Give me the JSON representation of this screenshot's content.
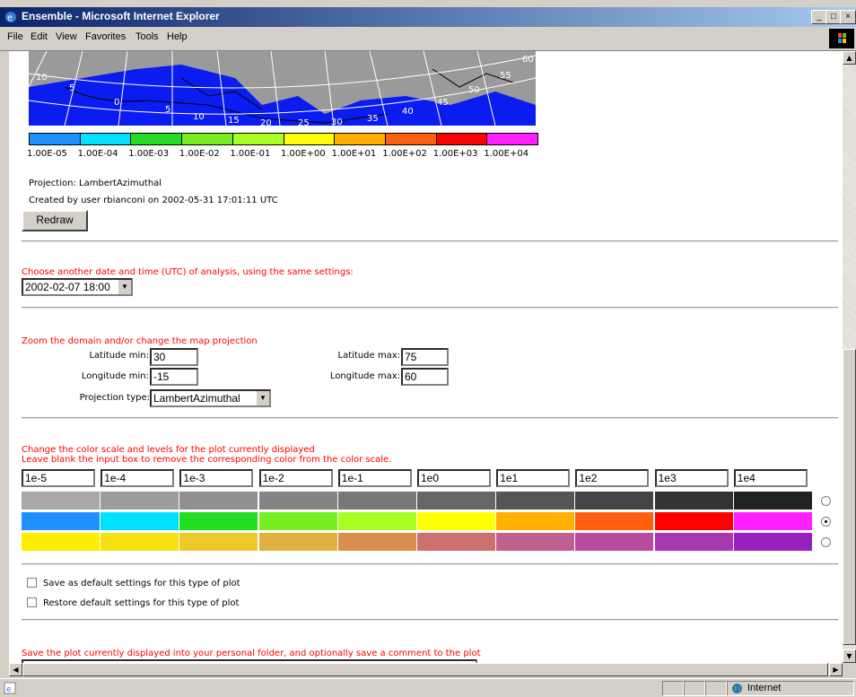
{
  "window": {
    "title": "Ensemble - Microsoft Internet Explorer",
    "minimize": "_",
    "maximize": "□",
    "close": "×"
  },
  "menu": [
    "File",
    "Edit",
    "View",
    "Favorites",
    "Tools",
    "Help"
  ],
  "map": {
    "lat_labels": [
      "10",
      "5",
      "0",
      "5",
      "10",
      "15",
      "20",
      "25",
      "30",
      "35",
      "40",
      "45",
      "50",
      "55",
      "60"
    ]
  },
  "color_scale": {
    "colors": [
      "#1e90ff",
      "#00e0ff",
      "#22dd22",
      "#77ee22",
      "#aaff22",
      "#ffff00",
      "#ffb000",
      "#ff6010",
      "#ff0000",
      "#ff20ff"
    ],
    "labels": [
      "1.00E-05",
      "1.00E-04",
      "1.00E-03",
      "1.00E-02",
      "1.00E-01",
      "1.00E+00",
      "1.00E+01",
      "1.00E+02",
      "1.00E+03",
      "1.00E+04"
    ]
  },
  "projection_text": "Projection: LambertAzimuthal",
  "created_text": "Created by user rbianconi on 2002-05-31 17:01:11 UTC",
  "redraw_label": "Redraw",
  "date_section": {
    "heading": "Choose another date and time (UTC) of analysis, using the same settings:",
    "selected": "2002-02-07 18:00"
  },
  "zoom_section": {
    "heading": "Zoom the domain and/or change the map projection",
    "lat_min_label": "Latitude min:",
    "lat_min_value": "30",
    "lat_max_label": "Latitude max:",
    "lat_max_value": "75",
    "lon_min_label": "Longitude min:",
    "lon_min_value": "-15",
    "lon_max_label": "Longitude max:",
    "lon_max_value": "60",
    "proj_label": "Projection type:",
    "proj_value": "LambertAzimuthal"
  },
  "levels_section": {
    "heading1": "Change the color scale and levels for the plot currently displayed",
    "heading2": "Leave blank the input box to remove the corresponding color from the color scale.",
    "levels": [
      "1e-5",
      "1e-4",
      "1e-3",
      "1e-2",
      "1e-1",
      "1e0",
      "1e1",
      "1e2",
      "1e3",
      "1e4"
    ],
    "palettes": [
      {
        "colors": [
          "#a8a8a8",
          "#9c9c9c",
          "#909090",
          "#848484",
          "#787878",
          "#666666",
          "#555555",
          "#444444",
          "#333333",
          "#222222"
        ],
        "selected": false
      },
      {
        "colors": [
          "#1e90ff",
          "#00e0ff",
          "#22dd22",
          "#77ee22",
          "#aaff22",
          "#ffff00",
          "#ffb000",
          "#ff6010",
          "#ff0000",
          "#ff20ff"
        ],
        "selected": true
      },
      {
        "colors": [
          "#ffee00",
          "#f6e010",
          "#eec828",
          "#e0b040",
          "#d8904c",
          "#cc7070",
          "#c06090",
          "#b84ca0",
          "#a838b0",
          "#9820c0"
        ],
        "selected": false
      }
    ]
  },
  "options": {
    "save_default": "Save as default settings for this type of plot",
    "restore_default": "Restore default settings for this type of plot"
  },
  "save_section": {
    "heading": "Save the plot currently displayed into your personal folder, and optionally save a comment to the plot"
  },
  "status": {
    "zone": "Internet"
  }
}
